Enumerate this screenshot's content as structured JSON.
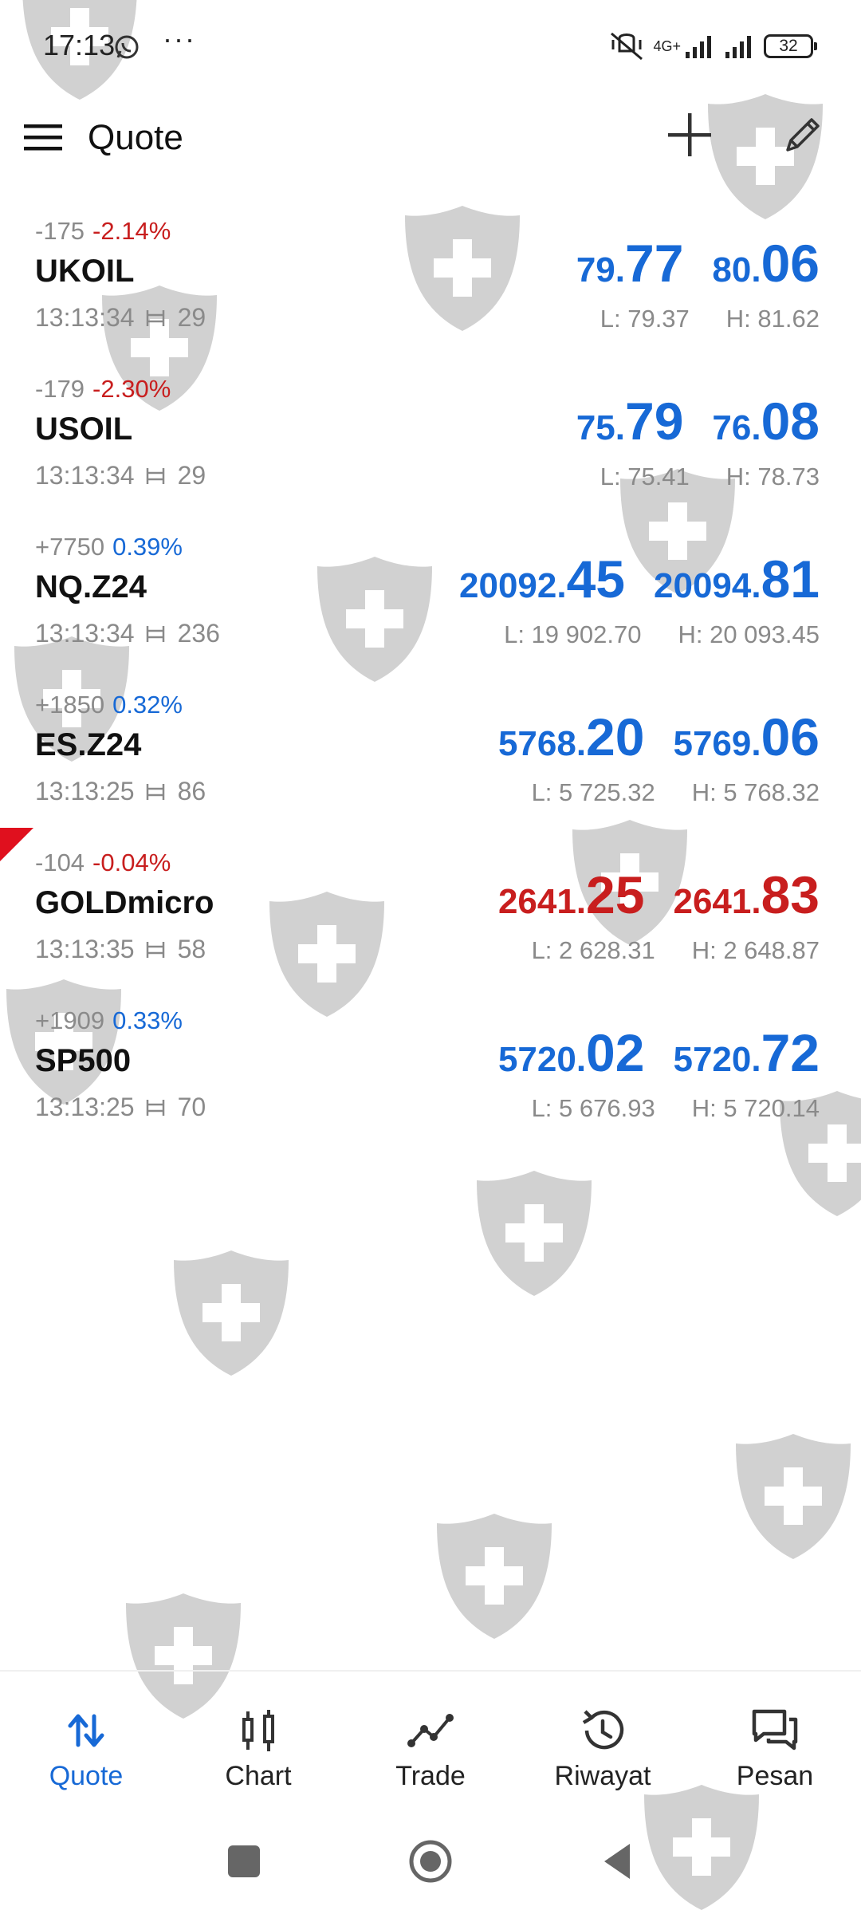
{
  "status_bar": {
    "time": "17:13",
    "dots": "···",
    "battery": "32",
    "network": "4G+"
  },
  "header": {
    "title": "Quote"
  },
  "quotes": [
    {
      "change": "-175",
      "percent": "-2.14%",
      "direction": "neg",
      "symbol": "UKOIL",
      "time": "13:13:34",
      "spread": "29",
      "bid_small": "79.",
      "bid_big": "77",
      "ask_small": "80.",
      "ask_big": "06",
      "price_color": "blue",
      "low": "L: 79.37",
      "high": "H: 81.62"
    },
    {
      "change": "-179",
      "percent": "-2.30%",
      "direction": "neg",
      "symbol": "USOIL",
      "time": "13:13:34",
      "spread": "29",
      "bid_small": "75.",
      "bid_big": "79",
      "ask_small": "76.",
      "ask_big": "08",
      "price_color": "blue",
      "low": "L: 75.41",
      "high": "H: 78.73"
    },
    {
      "change": "+7750",
      "percent": "0.39%",
      "direction": "pos",
      "symbol": "NQ.Z24",
      "time": "13:13:34",
      "spread": "236",
      "bid_small": "20092.",
      "bid_big": "45",
      "ask_small": "20094.",
      "ask_big": "81",
      "price_color": "blue",
      "low": "L: 19 902.70",
      "high": "H: 20 093.45"
    },
    {
      "change": "+1850",
      "percent": "0.32%",
      "direction": "pos",
      "symbol": "ES.Z24",
      "time": "13:13:25",
      "spread": "86",
      "bid_small": "5768.",
      "bid_big": "20",
      "ask_small": "5769.",
      "ask_big": "06",
      "price_color": "blue",
      "low": "L: 5 725.32",
      "high": "H: 5 768.32"
    },
    {
      "change": "-104",
      "percent": "-0.04%",
      "direction": "neg",
      "symbol": "GOLDmicro",
      "time": "13:13:35",
      "spread": "58",
      "bid_small": "2641.",
      "bid_big": "25",
      "ask_small": "2641.",
      "ask_big": "83",
      "price_color": "red",
      "low": "L: 2 628.31",
      "high": "H: 2 648.87"
    },
    {
      "change": "+1909",
      "percent": "0.33%",
      "direction": "pos",
      "symbol": "SP500",
      "time": "13:13:25",
      "spread": "70",
      "bid_small": "5720.",
      "bid_big": "02",
      "ask_small": "5720.",
      "ask_big": "72",
      "price_color": "blue",
      "low": "L: 5 676.93",
      "high": "H: 5 720.14"
    }
  ],
  "bottom_nav": {
    "items": [
      {
        "label": "Quote",
        "icon": "quote-arrows-icon",
        "active": true
      },
      {
        "label": "Chart",
        "icon": "candlestick-icon",
        "active": false
      },
      {
        "label": "Trade",
        "icon": "trend-line-icon",
        "active": false
      },
      {
        "label": "Riwayat",
        "icon": "history-icon",
        "active": false
      },
      {
        "label": "Pesan",
        "icon": "chat-bubbles-icon",
        "active": false
      }
    ]
  },
  "colors": {
    "accent_blue": "#1769d6",
    "negative_red": "#c81e1e",
    "muted_gray": "#8a8a8a"
  }
}
